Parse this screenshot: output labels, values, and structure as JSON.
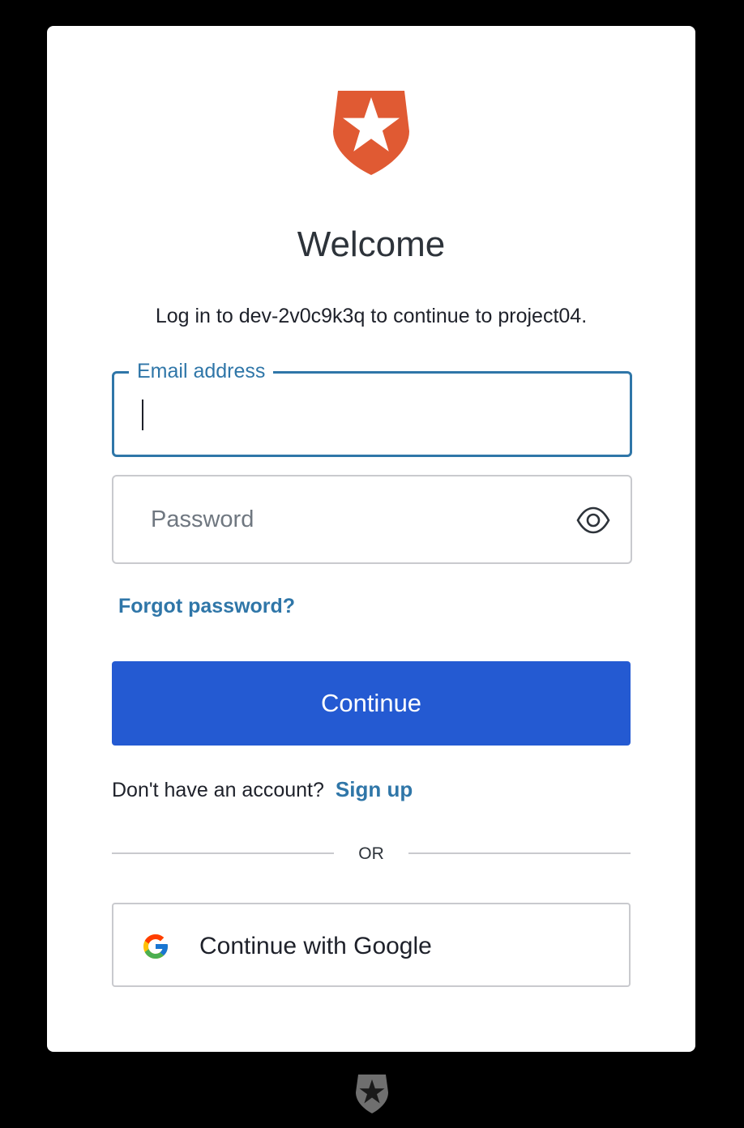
{
  "header": {
    "logo_icon": "auth0-shield-icon",
    "title": "Welcome",
    "subtitle": "Log in to dev-2v0c9k3q to continue to project04."
  },
  "form": {
    "email_label": "Email address",
    "email_value": "",
    "password_placeholder": "Password",
    "password_value": "",
    "show_password_icon": "eye-icon",
    "forgot_password": "Forgot password?",
    "continue_label": "Continue"
  },
  "signup": {
    "prompt": "Don't have an account?",
    "link": "Sign up"
  },
  "divider": {
    "text": "OR"
  },
  "social": {
    "google_label": "Continue with Google",
    "google_icon": "google-icon"
  },
  "footer": {
    "logo_icon": "auth0-logo-icon"
  },
  "colors": {
    "brand": "#e05a33",
    "accent": "#2f76a8",
    "primary_button": "#245ad2",
    "background": "#000000",
    "card": "#ffffff"
  }
}
